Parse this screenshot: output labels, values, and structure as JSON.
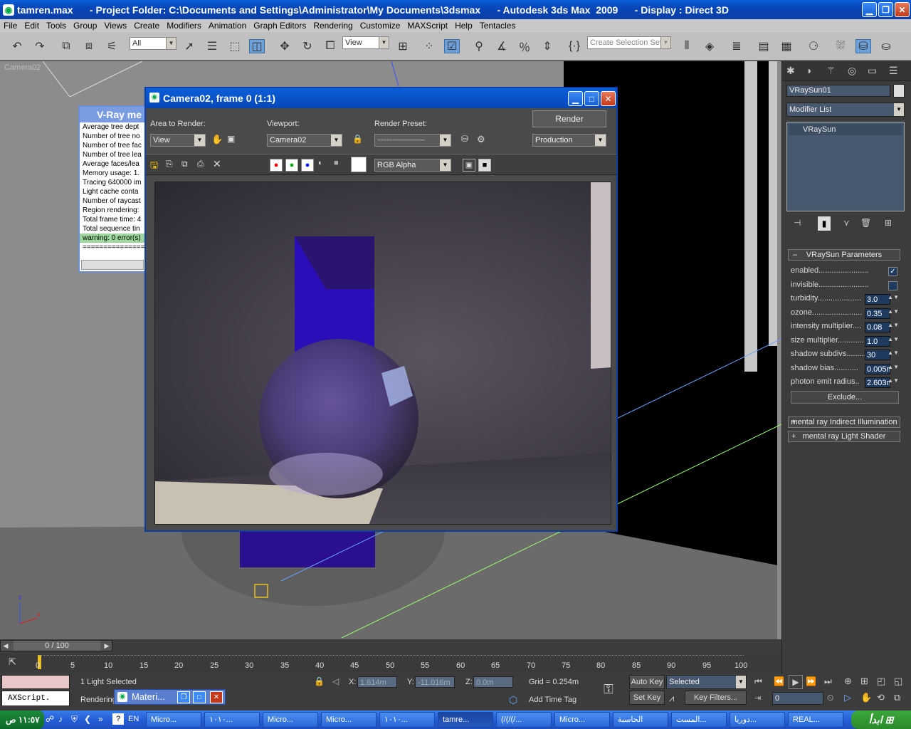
{
  "window": {
    "title": "tamren.max      - Project Folder: C:\\Documents and Settings\\Administrator\\My Documents\\3dsmax      - Autodesk 3ds Max  2009      - Display : Direct 3D"
  },
  "menu": [
    "File",
    "Edit",
    "Tools",
    "Group",
    "Views",
    "Create",
    "Modifiers",
    "Animation",
    "Graph Editors",
    "Rendering",
    "Customize",
    "MAXScript",
    "Help",
    "Tentacles"
  ],
  "toolbar": {
    "selection_filter": "All",
    "ref_coord": "View",
    "selection_set_placeholder": "Create Selection Set"
  },
  "viewport": {
    "label": "Camera02",
    "axis_x": "x",
    "axis_z": "z"
  },
  "vray_log": {
    "title": "V-Ray me",
    "lines": [
      "Average tree dept",
      "Number of tree no",
      "Number of tree fac",
      "Number of tree lea",
      "Average faces/lea",
      "Memory usage: 1.",
      "Tracing 640000 im",
      "Light cache conta",
      "Number of raycast",
      "Region rendering:",
      "Total frame time: 4",
      "Total sequence tin"
    ],
    "warning": "warning: 0 error(s)",
    "separator": "=================="
  },
  "render_window": {
    "title": "Camera02, frame 0 (1:1)",
    "area_label": "Area to Render:",
    "area_value": "View",
    "viewport_label": "Viewport:",
    "viewport_value": "Camera02",
    "preset_label": "Render Preset:",
    "preset_value": "-------------------------",
    "render_button": "Render",
    "production_value": "Production",
    "channel_value": "RGB Alpha"
  },
  "command_panel": {
    "object_name": "VRaySun01",
    "modifier_list": "Modifier List",
    "stack_item": "VRaySun",
    "rollout_title": "VRaySun Parameters",
    "rollout_toggle": "–",
    "params": [
      {
        "label": "enabled.......................",
        "type": "check",
        "checked": true
      },
      {
        "label": "invisible.......................",
        "type": "check",
        "checked": false
      },
      {
        "label": "turbidity....................",
        "value": "3.0"
      },
      {
        "label": "ozone.......................",
        "value": "0.35"
      },
      {
        "label": "intensity multiplier....",
        "value": "0.08"
      },
      {
        "label": "size multiplier............",
        "value": "1.0"
      },
      {
        "label": "shadow subdivs.........",
        "value": "30"
      },
      {
        "label": "shadow bias...........",
        "value": "0.005m"
      },
      {
        "label": "photon emit radius..",
        "value": "2.603m"
      }
    ],
    "exclude_button": "Exclude...",
    "rollout2": "mental ray Indirect Illumination",
    "rollout3": "mental ray Light Shader",
    "rollout_plus": "+"
  },
  "timeline": {
    "frame_counter": "0 / 100",
    "ticks": [
      "0",
      "5",
      "10",
      "15",
      "20",
      "25",
      "30",
      "35",
      "40",
      "45",
      "50",
      "55",
      "60",
      "65",
      "70",
      "75",
      "80",
      "85",
      "90",
      "95",
      "100"
    ]
  },
  "status": {
    "selection": "1 Light Selected",
    "prompt": "Rendering",
    "x_label": "X:",
    "x_value": "1.614m",
    "y_label": "Y:",
    "y_value": "-11.016m",
    "z_label": "Z:",
    "z_value": "0.0m",
    "grid": "Grid = 0.254m",
    "add_time_tag": "Add Time Tag",
    "auto_key": "Auto Key",
    "set_key": "Set Key",
    "selected_value": "Selected",
    "key_filters": "Key Filters...",
    "frame_field": "0",
    "maxscript": "AXScript.",
    "material_window": "Materi..."
  },
  "taskbar": {
    "start": "ابدأ",
    "clock": "١١:٥٧ ص",
    "lang": "EN",
    "tasks": [
      "Micro...",
      "١٠١٠...",
      "Micro...",
      "Micro...",
      "١٠١٠...",
      "tamre...",
      "(/(/(/...",
      "Micro...",
      "الحاسبة",
      "المست...",
      "دوريا...",
      "REAL..."
    ]
  }
}
